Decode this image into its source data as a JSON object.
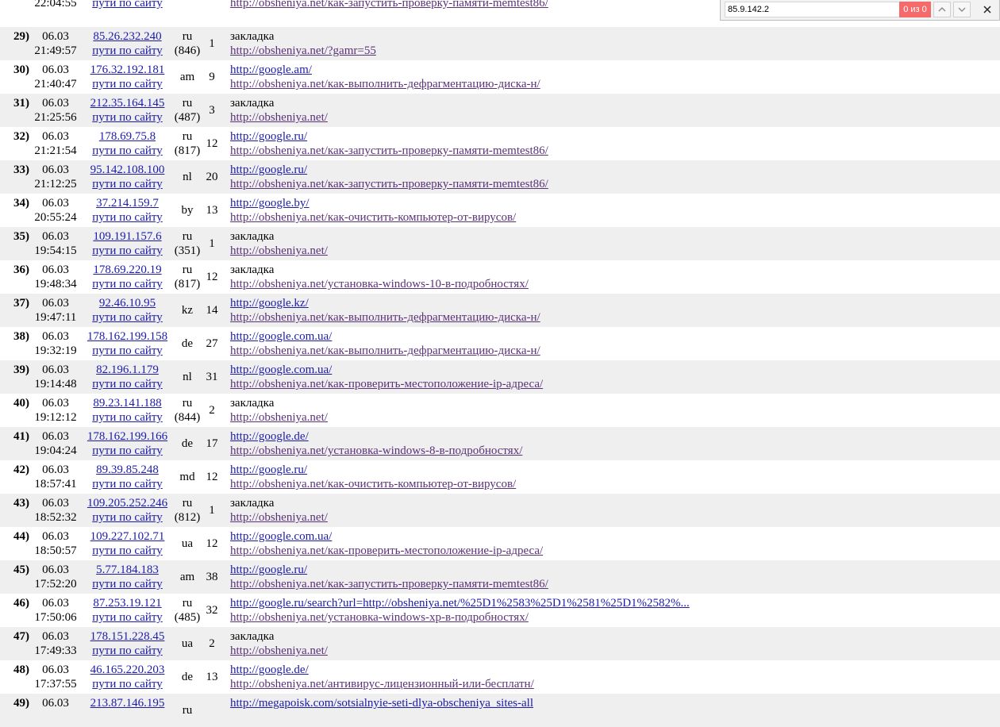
{
  "find_bar": {
    "query": "85.9.142.2",
    "match_count": "0 из 0",
    "prev_icon": "chevron-up-icon",
    "next_icon": "chevron-down-icon",
    "close_icon": "close-icon",
    "count_color": "#f56a6a"
  },
  "rows": [
    {
      "num": "",
      "date": "",
      "time": "22:04:55",
      "ip": "",
      "cc": "",
      "cc_extra": "",
      "count": "",
      "ref1": "",
      "ref1_link": false,
      "ref2": "http://obsheniya.net/как-запустить-проверку-памяти-memtest86/",
      "paths": "пути по сайту"
    },
    {
      "num": "29)",
      "date": "06.03",
      "time": "21:49:57",
      "ip": "85.26.232.240",
      "cc": "ru",
      "cc_extra": "(846)",
      "count": "1",
      "ref1": "закладка",
      "ref1_link": false,
      "ref2": "http://obsheniya.net/?gamr=55",
      "paths": "пути по сайту"
    },
    {
      "num": "30)",
      "date": "06.03",
      "time": "21:40:47",
      "ip": "176.32.192.181",
      "cc": "am",
      "cc_extra": "",
      "count": "9",
      "ref1": "http://google.am/",
      "ref1_link": true,
      "ref2": "http://obsheniya.net/как-выполнить-дефрагментацию-диска-н/",
      "paths": "пути по сайту"
    },
    {
      "num": "31)",
      "date": "06.03",
      "time": "21:25:56",
      "ip": "212.35.164.145",
      "cc": "ru",
      "cc_extra": "(487)",
      "count": "3",
      "ref1": "закладка",
      "ref1_link": false,
      "ref2": "http://obsheniya.net/",
      "paths": "пути по сайту"
    },
    {
      "num": "32)",
      "date": "06.03",
      "time": "21:21:54",
      "ip": "178.69.75.8",
      "cc": "ru",
      "cc_extra": "(817)",
      "count": "12",
      "ref1": "http://google.ru/",
      "ref1_link": true,
      "ref2": "http://obsheniya.net/как-запустить-проверку-памяти-memtest86/",
      "paths": "пути по сайту"
    },
    {
      "num": "33)",
      "date": "06.03",
      "time": "21:12:25",
      "ip": "95.142.108.100",
      "cc": "nl",
      "cc_extra": "",
      "count": "20",
      "ref1": "http://google.ru/",
      "ref1_link": true,
      "ref2": "http://obsheniya.net/как-запустить-проверку-памяти-memtest86/",
      "paths": "пути по сайту"
    },
    {
      "num": "34)",
      "date": "06.03",
      "time": "20:55:24",
      "ip": "37.214.159.7",
      "cc": "by",
      "cc_extra": "",
      "count": "13",
      "ref1": "http://google.by/",
      "ref1_link": true,
      "ref2": "http://obsheniya.net/как-очистить-компьютер-от-вирусов/",
      "paths": "пути по сайту"
    },
    {
      "num": "35)",
      "date": "06.03",
      "time": "19:54:15",
      "ip": "109.191.157.6",
      "cc": "ru",
      "cc_extra": "(351)",
      "count": "1",
      "ref1": "закладка",
      "ref1_link": false,
      "ref2": "http://obsheniya.net/",
      "paths": "пути по сайту"
    },
    {
      "num": "36)",
      "date": "06.03",
      "time": "19:48:34",
      "ip": "178.69.220.19",
      "cc": "ru",
      "cc_extra": "(817)",
      "count": "12",
      "ref1": "закладка",
      "ref1_link": false,
      "ref2": "http://obsheniya.net/установка-windows-10-в-подробностях/",
      "paths": "пути по сайту"
    },
    {
      "num": "37)",
      "date": "06.03",
      "time": "19:47:11",
      "ip": "92.46.10.95",
      "cc": "kz",
      "cc_extra": "",
      "count": "14",
      "ref1": "http://google.kz/",
      "ref1_link": true,
      "ref2": "http://obsheniya.net/как-выполнить-дефрагментацию-диска-н/",
      "paths": "пути по сайту"
    },
    {
      "num": "38)",
      "date": "06.03",
      "time": "19:32:19",
      "ip": "178.162.199.158",
      "cc": "de",
      "cc_extra": "",
      "count": "27",
      "ref1": "http://google.com.ua/",
      "ref1_link": true,
      "ref2": "http://obsheniya.net/как-выполнить-дефрагментацию-диска-н/",
      "paths": "пути по сайту"
    },
    {
      "num": "39)",
      "date": "06.03",
      "time": "19:14:48",
      "ip": "82.196.1.179",
      "cc": "nl",
      "cc_extra": "",
      "count": "31",
      "ref1": "http://google.com.ua/",
      "ref1_link": true,
      "ref2": "http://obsheniya.net/как-проверить-местоположение-ip-адреса/",
      "paths": "пути по сайту"
    },
    {
      "num": "40)",
      "date": "06.03",
      "time": "19:12:12",
      "ip": "89.23.141.188",
      "cc": "ru",
      "cc_extra": "(844)",
      "count": "2",
      "ref1": "закладка",
      "ref1_link": false,
      "ref2": "http://obsheniya.net/",
      "paths": "пути по сайту"
    },
    {
      "num": "41)",
      "date": "06.03",
      "time": "19:04:24",
      "ip": "178.162.199.166",
      "cc": "de",
      "cc_extra": "",
      "count": "17",
      "ref1": "http://google.de/",
      "ref1_link": true,
      "ref2": "http://obsheniya.net/установка-windows-8-в-подробностях/",
      "paths": "пути по сайту"
    },
    {
      "num": "42)",
      "date": "06.03",
      "time": "18:57:41",
      "ip": "89.39.85.248",
      "cc": "md",
      "cc_extra": "",
      "count": "12",
      "ref1": "http://google.ru/",
      "ref1_link": true,
      "ref2": "http://obsheniya.net/как-очистить-компьютер-от-вирусов/",
      "paths": "пути по сайту"
    },
    {
      "num": "43)",
      "date": "06.03",
      "time": "18:52:32",
      "ip": "109.205.252.246",
      "cc": "ru",
      "cc_extra": "(812)",
      "count": "1",
      "ref1": "закладка",
      "ref1_link": false,
      "ref2": "http://obsheniya.net/",
      "paths": "пути по сайту"
    },
    {
      "num": "44)",
      "date": "06.03",
      "time": "18:50:57",
      "ip": "109.227.102.71",
      "cc": "ua",
      "cc_extra": "",
      "count": "12",
      "ref1": "http://google.com.ua/",
      "ref1_link": true,
      "ref2": "http://obsheniya.net/как-проверить-местоположение-ip-адреса/",
      "paths": "пути по сайту"
    },
    {
      "num": "45)",
      "date": "06.03",
      "time": "17:52:20",
      "ip": "5.77.184.183",
      "cc": "am",
      "cc_extra": "",
      "count": "38",
      "ref1": "http://google.ru/",
      "ref1_link": true,
      "ref2": "http://obsheniya.net/как-запустить-проверку-памяти-memtest86/",
      "paths": "пути по сайту"
    },
    {
      "num": "46)",
      "date": "06.03",
      "time": "17:50:06",
      "ip": "87.253.19.121",
      "cc": "ru",
      "cc_extra": "(485)",
      "count": "32",
      "ref1": "http://google.ru/search?url=http://obsheniya.net/%25D1%2583%25D1%2581%25D1%2582%...",
      "ref1_link": true,
      "ref2": "http://obsheniya.net/установка-windows-xp-в-подробностях/",
      "paths": "пути по сайту"
    },
    {
      "num": "47)",
      "date": "06.03",
      "time": "17:49:33",
      "ip": "178.151.228.45",
      "cc": "ua",
      "cc_extra": "",
      "count": "2",
      "ref1": "закладка",
      "ref1_link": false,
      "ref2": "http://obsheniya.net/",
      "paths": "пути по сайту"
    },
    {
      "num": "48)",
      "date": "06.03",
      "time": "17:37:55",
      "ip": "46.165.220.203",
      "cc": "de",
      "cc_extra": "",
      "count": "13",
      "ref1": "http://google.de/",
      "ref1_link": true,
      "ref2": "http://obsheniya.net/антивирус-лицензионный-или-бесплатн/",
      "paths": "пути по сайту"
    },
    {
      "num": "49)",
      "date": "06.03",
      "time": "",
      "ip": "213.87.146.195",
      "cc": "ru",
      "cc_extra": "",
      "count": "",
      "ref1": "http://megapoisk.com/sotsialnyie-seti-dlya-obscheniya_sites-all",
      "ref1_link": true,
      "ref2": "",
      "paths": ""
    }
  ]
}
